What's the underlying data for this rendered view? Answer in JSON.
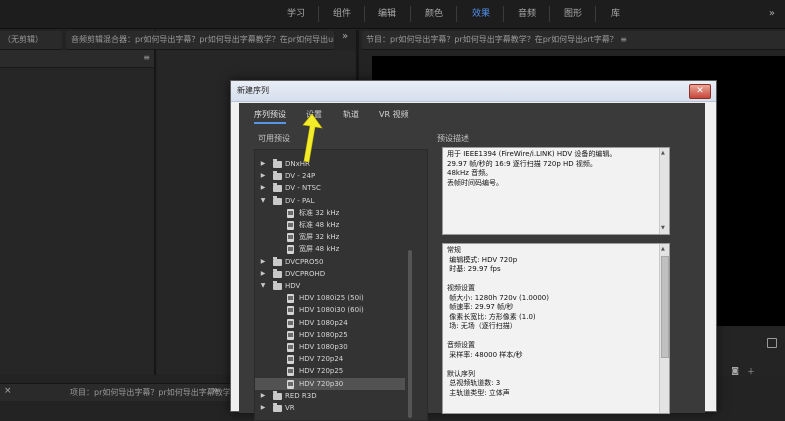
{
  "workspace": {
    "tabs": [
      "学习",
      "组件",
      "编辑",
      "颜色",
      "效果",
      "音频",
      "图形",
      "库"
    ],
    "active_tab": "效果",
    "more": "»"
  },
  "panels": {
    "left_header": "（无剪辑）",
    "middle_header": "音频剪辑混合器：pr如何导出字幕？pr如何导出字幕教学？在pr如何导出ui",
    "right_header": "节目：pr如何导出字幕？pr如何导出字幕教学？在pr如何导出srt字幕？ ≡",
    "more_1": "»",
    "more_2": "»",
    "bottom_project": "项目：pr如何导出字幕？pr如何导出字幕教学？",
    "bottom_more": "»"
  },
  "dialog": {
    "title": "新建序列",
    "close": "✕",
    "tabs": [
      "序列预设",
      "设置",
      "轨道",
      "VR 视频"
    ],
    "active_tab": "序列预设",
    "available_presets_label": "可用预设",
    "preset_description_label": "预设描述",
    "tree": [
      {
        "label": "DNxHR",
        "level": 0,
        "type": "folder",
        "expanded": false
      },
      {
        "label": "DV - 24P",
        "level": 0,
        "type": "folder",
        "expanded": false
      },
      {
        "label": "DV - NTSC",
        "level": 0,
        "type": "folder",
        "expanded": false
      },
      {
        "label": "DV - PAL",
        "level": 0,
        "type": "folder",
        "expanded": true
      },
      {
        "label": "标准 32 kHz",
        "level": 1,
        "type": "file"
      },
      {
        "label": "标准 48 kHz",
        "level": 1,
        "type": "file"
      },
      {
        "label": "宽屏 32 kHz",
        "level": 1,
        "type": "file"
      },
      {
        "label": "宽屏 48 kHz",
        "level": 1,
        "type": "file"
      },
      {
        "label": "DVCPRO50",
        "level": 0,
        "type": "folder",
        "expanded": false
      },
      {
        "label": "DVCPROHD",
        "level": 0,
        "type": "folder",
        "expanded": false
      },
      {
        "label": "HDV",
        "level": 0,
        "type": "folder",
        "expanded": true
      },
      {
        "label": "HDV 1080i25 (50i)",
        "level": 1,
        "type": "file"
      },
      {
        "label": "HDV 1080i30 (60i)",
        "level": 1,
        "type": "file"
      },
      {
        "label": "HDV 1080p24",
        "level": 1,
        "type": "file"
      },
      {
        "label": "HDV 1080p25",
        "level": 1,
        "type": "file"
      },
      {
        "label": "HDV 1080p30",
        "level": 1,
        "type": "file"
      },
      {
        "label": "HDV 720p24",
        "level": 1,
        "type": "file"
      },
      {
        "label": "HDV 720p25",
        "level": 1,
        "type": "file"
      },
      {
        "label": "HDV 720p30",
        "level": 1,
        "type": "file",
        "selected": true
      },
      {
        "label": "RED R3D",
        "level": 0,
        "type": "folder",
        "expanded": false
      },
      {
        "label": "VR",
        "level": 0,
        "type": "folder",
        "expanded": false
      }
    ],
    "description_lines": [
      "用于 IEEE1394 (FireWire/i.LINK) HDV 设备的编辑。",
      "29.97 帧/秒的 16:9 逐行扫描 720p HD 视频。",
      "48kHz 音频。",
      "丢帧时间码编号。"
    ],
    "details_lines": [
      "常规",
      " 编辑模式: HDV 720p",
      " 时基: 29.97 fps",
      "",
      "视频设置",
      " 帧大小: 1280h 720v (1.0000)",
      " 帧速率: 29.97 帧/秒",
      " 像素长宽比: 方形像素 (1.0)",
      " 场: 无场（逐行扫描）",
      "",
      "音频设置",
      " 采样率: 48000 样本/秒",
      "",
      "默认序列",
      " 总视频轨道数: 3",
      " 主轨道类型: 立体声"
    ]
  },
  "colors": {
    "accent": "#4f8fe8",
    "arrow": "#f2ec2a"
  }
}
